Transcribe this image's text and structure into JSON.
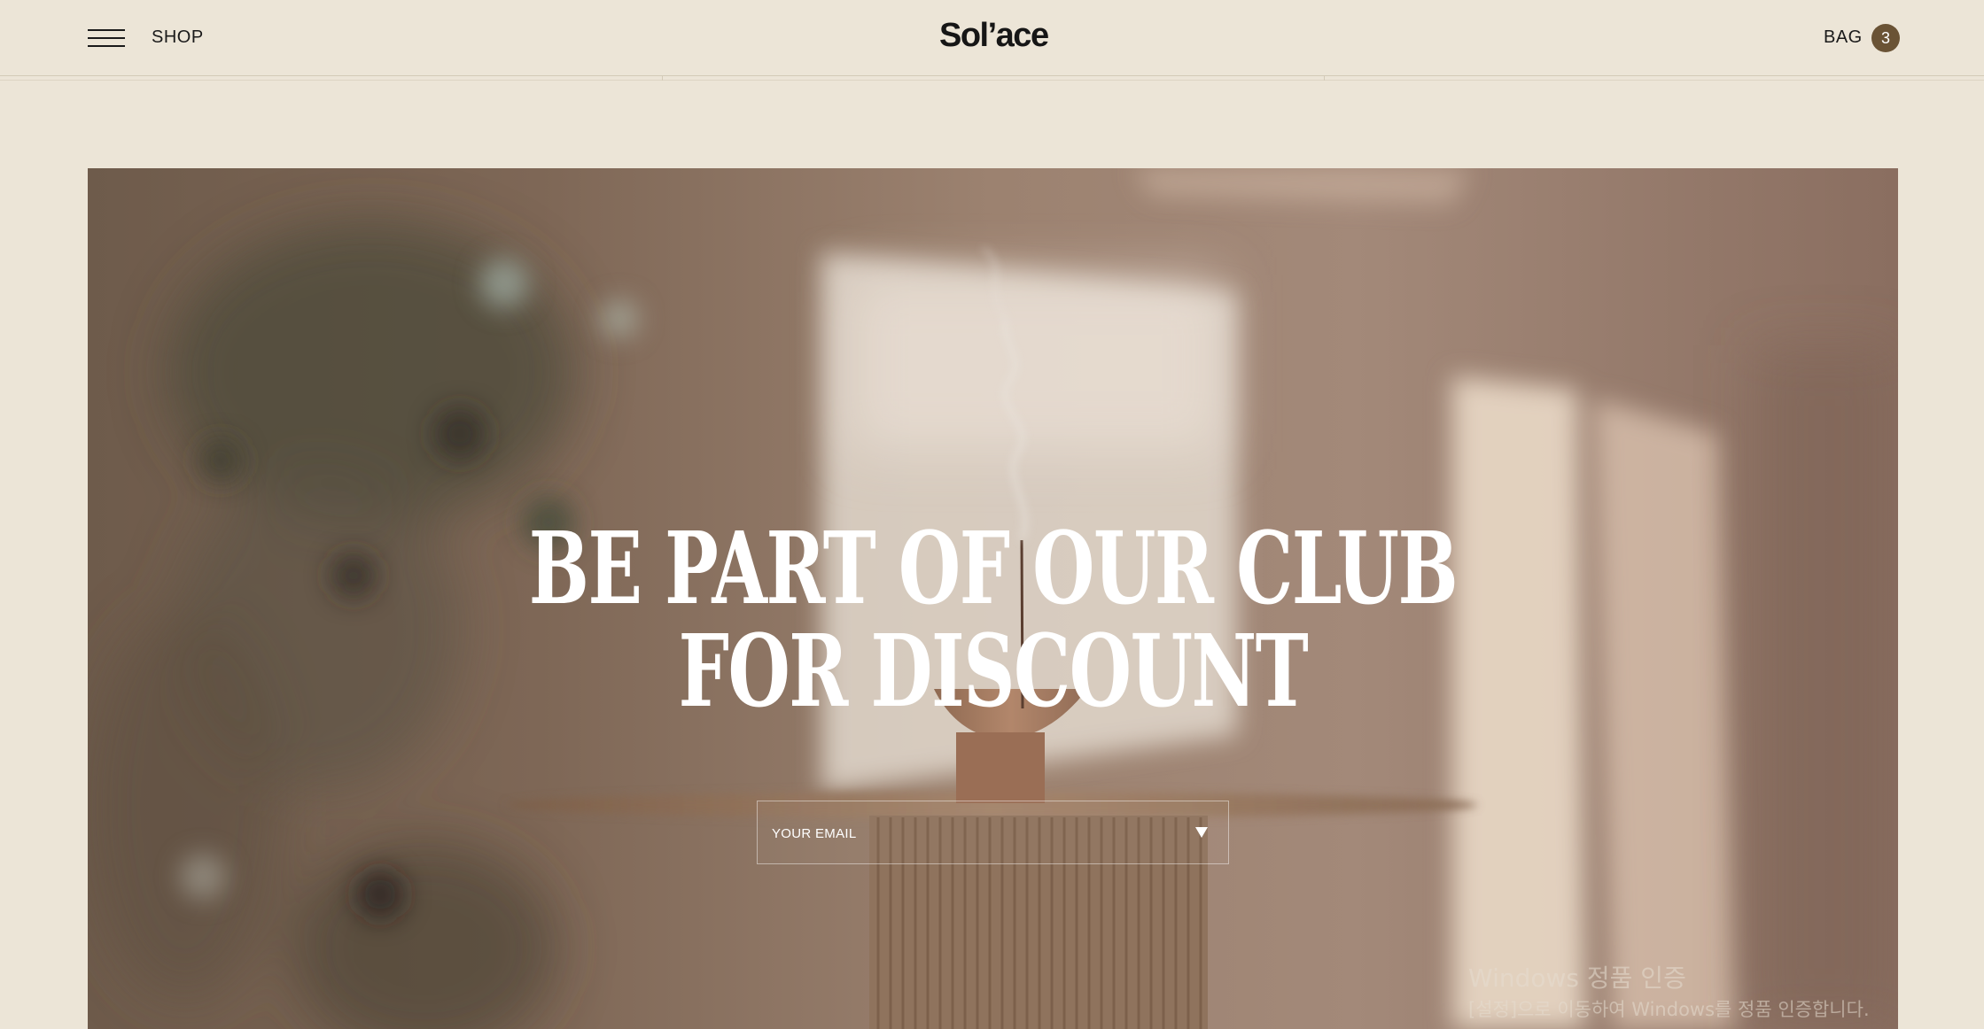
{
  "header": {
    "shop_label": "SHOP",
    "logo_text": "Sol’ace",
    "bag_label": "BAG",
    "bag_count": "3"
  },
  "hero": {
    "title": "BE PART OF OUR CLUB\nFOR DISCOUNT",
    "email_placeholder": "YOUR EMAIL"
  },
  "watermark": {
    "title": "Windows 정품 인증",
    "subtitle": "[설정]으로 이동하여 Windows를 정품 인증합니다."
  },
  "colors": {
    "page_background": "#ece5d7",
    "bag_badge": "#6a5335",
    "text": "#1a1a1a"
  }
}
